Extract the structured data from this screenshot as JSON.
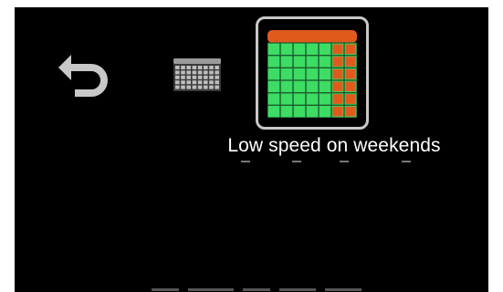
{
  "menu": {
    "back_icon": "back-arrow-icon",
    "items": [
      {
        "icon": "calendar-grid-icon",
        "selected": false
      },
      {
        "icon": "weekend-calendar-icon",
        "selected": true
      }
    ],
    "selected_caption": "Low speed on weekends"
  },
  "colors": {
    "background": "#000000",
    "back_icon": "#c8c8c8",
    "selection_border": "#c8c8c8",
    "calendar_header": "#e05a1e",
    "weekday_cells": "#3ddc64",
    "weekend_cells": "#e05a1e",
    "caption": "#ffffff"
  }
}
